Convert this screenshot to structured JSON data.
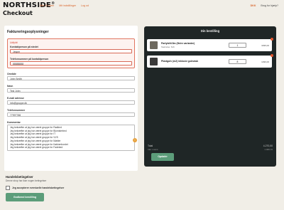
{
  "brand": {
    "logo_text": "NORTHSIDE",
    "logo_sup": "®"
  },
  "nav": [
    {
      "label": "Alle 13 varer"
    },
    {
      "label": "Mit indstillinger"
    },
    {
      "label": "Log ud"
    }
  ],
  "header_right": {
    "lang": "DKK",
    "help": "Brug for hjælp?"
  },
  "page": {
    "title": "Checkout"
  },
  "billing": {
    "title": "Faktureringsoplysninger",
    "error_message": "Udfyldt",
    "contact_person_label": "Kontaktperson på stedet",
    "contact_person_value": "Jesper",
    "contact_phone_label": "Telefonnummer på kontaktperson",
    "contact_phone_value": "88888888",
    "company_label": "Område",
    "company_value": "John Smith",
    "name_label": "Navn",
    "name_value": "Test John",
    "email_label": "E-mail adresse",
    "email_value": "info@gruppe.dk",
    "phone_label": "Telefonnummer",
    "phone_value": "77997788",
    "comment_label": "Kommentar",
    "comment_lines": [
      "Jeg bekræfter at jeg har været gruppe for Rødbed",
      "Jeg bekræfter at jeg har været gruppe for Blomsterbed",
      "Jeg bekræfter at jeg har været gruppe for IT",
      "Jeg bekræfter at jeg har været gruppe for VVS",
      "Jeg bekræfter at jeg har været gruppe for Møbler",
      "Jeg bekræfter at jeg har været gruppe for Køkkenbordet",
      "Jeg bekræfter at jeg har været gruppe for Fadebed"
    ],
    "comment_counter": "!"
  },
  "terms": {
    "title": "Handelsbetingelser",
    "subtitle": "Denne shop har ikke nogen betingelser",
    "accept_label": "Jeg accepterer eventuelle handelsbetingelser"
  },
  "submit_label": "Godkend bestilling",
  "order": {
    "title": "Din bestilling",
    "items": [
      {
        "name": "Partyteltt 8m (fleire varianter)",
        "sub": "Størrelse: 6x6",
        "qty": "1",
        "price": "3395,00",
        "thumb_color": "#6e6a5f"
      },
      {
        "name": "Plastgulv (m2) inklusiv gulvvask",
        "sub": "",
        "qty": "8",
        "price": "1096,00",
        "thumb_color": "#3a3a3a"
      }
    ],
    "total_label": "Total",
    "total_value": "4.270,00",
    "vat_label": "Inkl. moms",
    "vat_value": "1.068,76",
    "update_label": "Opdatér"
  }
}
